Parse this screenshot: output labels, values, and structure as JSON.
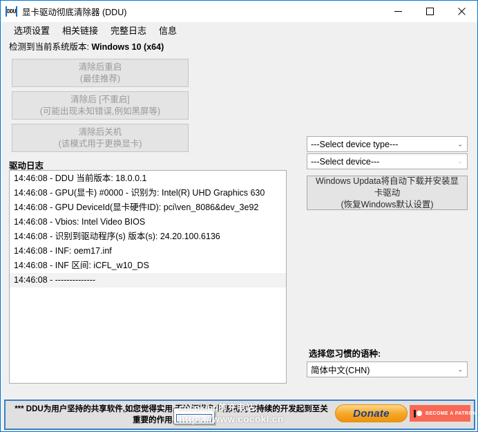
{
  "window": {
    "title": "显卡驱动彻底清除器 (DDU)",
    "icon": "ddu-logo-icon",
    "controls": {
      "minimize": "minimize-icon",
      "maximize": "maximize-icon",
      "close": "close-icon"
    }
  },
  "menu": {
    "items": [
      {
        "label": "选项设置"
      },
      {
        "label": "相关链接"
      },
      {
        "label": "完整日志"
      },
      {
        "label": "信息"
      }
    ]
  },
  "left": {
    "system_version_prefix": "检测到当前系统版本: ",
    "system_version_value": "Windows 10 (x64)",
    "buttons": [
      {
        "title": "清除后重启",
        "subtitle": "(最佳推荐)",
        "enabled": false
      },
      {
        "title": "清除后 [不重启]",
        "subtitle": "(可能出现未知错误,例如黑屏等)",
        "enabled": false
      },
      {
        "title": "清除后关机",
        "subtitle": "(该模式用于更换显卡)",
        "enabled": false
      }
    ],
    "log_label": "驱动日志",
    "log_lines": [
      "14:46:08 - DDU 当前版本: 18.0.0.1",
      "14:46:08 - GPU(显卡) #0000 - 识别为: Intel(R) UHD Graphics 630",
      "14:46:08 - GPU DeviceId(显卡硬件ID): pci\\ven_8086&dev_3e92",
      "14:46:08 - Vbios: Intel Video BIOS",
      "14:46:08 - 识别到驱动程序(s) 版本(s): 24.20.100.6136",
      "14:46:08 - INF: oem17.inf",
      "14:46:08 - INF 区间: iCFL_w10_DS",
      "14:46:08 - --------------"
    ]
  },
  "right": {
    "device_type_value": "---Select device type---",
    "device_value": "---Select device---",
    "winupdate_line1": "Windows Updata将自动下载并安装显",
    "winupdate_line2": "卡驱动",
    "winupdate_line3": "(恢复Windows默认设置)",
    "lang_label": "选择您习惯的语种:",
    "lang_value": "简体中文(CHN)",
    "chevron": "⌄"
  },
  "banner": {
    "line1": "*** DDU为用户坚持的共享软件,如您觉得实用,无论打赏多少,都将对它持续的开发起到至关",
    "line2": "重要的作用,感谢!!! ***",
    "donate_label": "Donate",
    "patron_label": "BECOME A PATRON",
    "donate_color": "#f5a623",
    "patron_color": "#f96854"
  },
  "overlay": {
    "watermark_line1": "cocoking的充电站",
    "watermark_line2": "https://www.cocokl.cn"
  }
}
